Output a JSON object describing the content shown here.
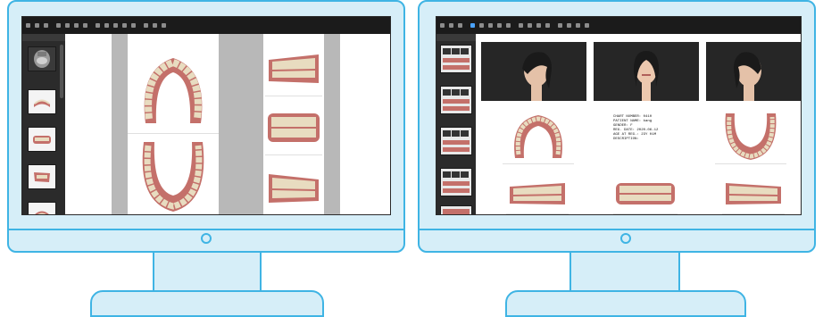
{
  "monitors": [
    {
      "id": "left",
      "view": "arch-occlusal-and-buccal"
    },
    {
      "id": "right",
      "view": "photo-and-model-layout"
    }
  ],
  "patient_info": {
    "line1": "CHART NUMBER: 0410",
    "line2": "PATIENT NAME: kang",
    "line3": "GENDER: F",
    "line4": "REG. DATE: 2020-06-12",
    "line5": "AGE AT REG.: 23Y 01M",
    "line6": "DESCRIPTION:"
  },
  "colors": {
    "frame": "#3fb4e4",
    "bezel_fill": "#d6eef8",
    "toolbar": "#1b1b1b",
    "sidebar": "#2b2b2b",
    "gingiva": "#c4706a",
    "teeth": "#e8dcc0"
  },
  "icons": [
    "monitor-power-icon",
    "toolbar-tool-icon",
    "thumbnail-icon"
  ]
}
